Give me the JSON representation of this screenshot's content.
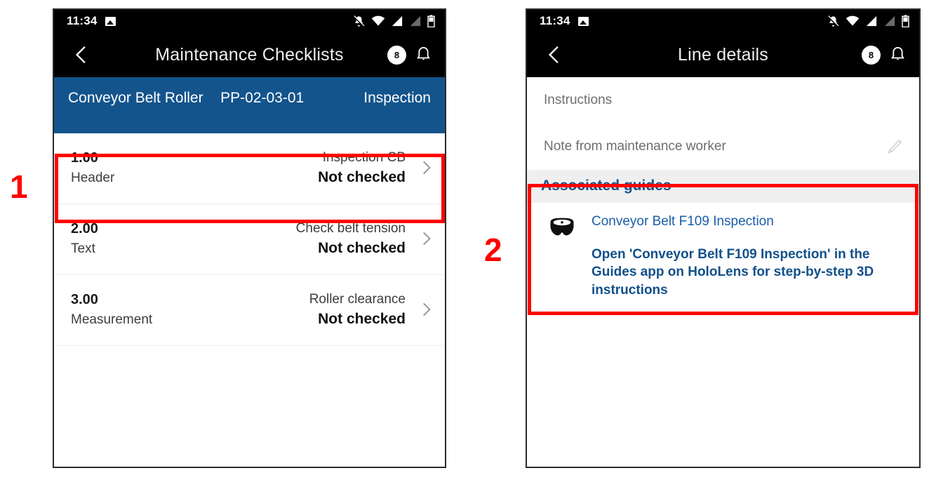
{
  "status_bar": {
    "time": "11:34",
    "icons": [
      "image-icon",
      "notifications-off-icon",
      "wifi-icon",
      "cellular-signal-icon",
      "cellular-signal-off-icon",
      "battery-icon"
    ]
  },
  "left_phone": {
    "app_bar": {
      "back_icon": "back-chevron-icon",
      "title": "Maintenance Checklists",
      "badge_count": "8",
      "bell_icon": "bell-icon"
    },
    "context_band": {
      "asset": "Conveyor Belt Roller",
      "code": "PP-02-03-01",
      "job_type": "Inspection",
      "background_color": "#14548c"
    },
    "checklist_rows": [
      {
        "number": "1.00",
        "type": "Header",
        "name": "Inspection CB",
        "status": "Not checked",
        "chevron": "chevron-right-icon"
      },
      {
        "number": "2.00",
        "type": "Text",
        "name": "Check belt tension",
        "status": "Not checked",
        "chevron": "chevron-right-icon"
      },
      {
        "number": "3.00",
        "type": "Measurement",
        "name": "Roller clearance",
        "status": "Not checked",
        "chevron": "chevron-right-icon"
      }
    ]
  },
  "right_phone": {
    "app_bar": {
      "back_icon": "back-chevron-icon",
      "title": "Line details",
      "badge_count": "8",
      "bell_icon": "bell-icon"
    },
    "fields": [
      {
        "label": "Instructions",
        "has_edit_icon": false
      },
      {
        "label": "Note from maintenance worker",
        "has_edit_icon": true,
        "edit_icon": "pencil-icon"
      }
    ],
    "associated_guides": {
      "section_title": "Associated guides",
      "section_title_color": "#12508a",
      "guide_icon": "hololens-goggles-icon",
      "guide_name": "Conveyor Belt F109 Inspection",
      "guide_cta": "Open 'Conveyor Belt F109 Inspection' in the Guides app on HoloLens for step-by-step 3D instructions"
    }
  },
  "annotations": {
    "marker_color": "#fe0000",
    "markers": [
      {
        "label": "1",
        "target": "checklist-row-1"
      },
      {
        "label": "2",
        "target": "associated-guides-section"
      }
    ]
  }
}
